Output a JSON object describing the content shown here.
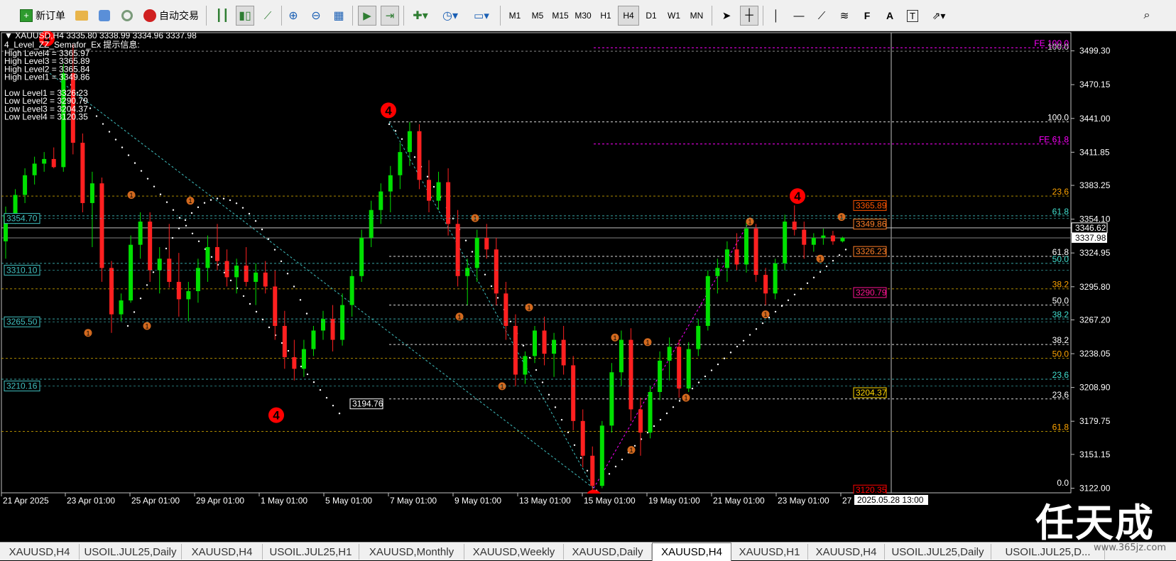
{
  "toolbar": {
    "new_order": "新订单",
    "auto_trading": "自动交易",
    "timeframes": [
      "M1",
      "M5",
      "M15",
      "M30",
      "H1",
      "H4",
      "D1",
      "W1",
      "MN"
    ],
    "active_timeframe": "H4"
  },
  "info": {
    "header": "XAUUSD,H4  3335.80 3338.99 3334.96 3337.98",
    "indicator": "4_Level_ZZ_Semafor_Ex 提示信息:",
    "lines": [
      "High Level4 = 3365.97",
      "High Level3 = 3365.89",
      "High Level2 = 3365.84",
      "High Level1 = 3349.86",
      "",
      "Low Level1 = 3326.23",
      "Low Level2 = 3290.79",
      "Low Level3 = 3204.37",
      "Low Level4 = 3120.35"
    ]
  },
  "chart_data": {
    "type": "candlestick",
    "symbol": "XAUUSD",
    "timeframe": "H4",
    "ylim": [
      3118,
      3515
    ],
    "y_ticks": [
      "3499.30",
      "3470.15",
      "3441.00",
      "3411.85",
      "3383.25",
      "3354.10",
      "3324.95",
      "3295.80",
      "3267.20",
      "3238.05",
      "3208.90",
      "3179.75",
      "3151.15",
      "3122.00"
    ],
    "x_labels": [
      "21 Apr 2025",
      "23 Apr 01:00",
      "25 Apr 01:00",
      "29 Apr 01:00",
      "1 May 01:00",
      "5 May 01:00",
      "7 May 01:00",
      "9 May 01:00",
      "13 May 01:00",
      "15 May 01:00",
      "19 May 01:00",
      "21 May 01:00",
      "23 May 01:00",
      "27"
    ],
    "crosshair_time": "2025.05.28 13:00",
    "price_labels": {
      "current": "3337.98",
      "crosshair": "3346.62"
    },
    "left_levels": [
      "3354.70",
      "3310.10",
      "3265.50",
      "3210.16"
    ],
    "swing_label": "3194.76",
    "right_level_boxes": [
      {
        "text": "3365.89",
        "price": 3365.9,
        "color": "#ff5500"
      },
      {
        "text": "3349.86",
        "price": 3349.86,
        "color": "#ff7f27"
      },
      {
        "text": "3326.23",
        "price": 3326.23,
        "color": "#ff7f27"
      },
      {
        "text": "3290.79",
        "price": 3290.79,
        "color": "#ff1493"
      },
      {
        "text": "3204.37",
        "price": 3204.37,
        "color": "#ffd700"
      },
      {
        "text": "3120.35",
        "price": 3120.35,
        "color": "#ff0000"
      }
    ],
    "fib_labels": [
      {
        "text": "FE 100.0",
        "price": 3502,
        "color": "#ff00ff"
      },
      {
        "text": "100.0",
        "price": 3499,
        "color": "#d0d0d0"
      },
      {
        "text": "100.0",
        "price": 3438,
        "color": "#ffffff"
      },
      {
        "text": "FE 61.8",
        "price": 3419,
        "color": "#ff00ff"
      },
      {
        "text": "23.6",
        "price": 3374,
        "color": "#ffa500"
      },
      {
        "text": "61.8",
        "price": 3357,
        "color": "#40e0d0"
      },
      {
        "text": "61.8",
        "price": 3322,
        "color": "#ffffff"
      },
      {
        "text": "50.0",
        "price": 3316,
        "color": "#40e0d0"
      },
      {
        "text": "38.2",
        "price": 3294,
        "color": "#ffa500"
      },
      {
        "text": "50.0",
        "price": 3280,
        "color": "#ffffff"
      },
      {
        "text": "38.2",
        "price": 3268,
        "color": "#40e0d0"
      },
      {
        "text": "38.2",
        "price": 3246,
        "color": "#ffffff"
      },
      {
        "text": "50.0",
        "price": 3234,
        "color": "#ffa500"
      },
      {
        "text": "23.6",
        "price": 3216,
        "color": "#40e0d0"
      },
      {
        "text": "23.6",
        "price": 3199,
        "color": "#ffffff"
      },
      {
        "text": "61.8",
        "price": 3171,
        "color": "#ffa500"
      },
      {
        "text": "0.0",
        "price": 3123,
        "color": "#ffffff"
      }
    ],
    "candles": [
      [
        3335,
        3365,
        3320,
        3358
      ],
      [
        3358,
        3380,
        3350,
        3375
      ],
      [
        3375,
        3398,
        3368,
        3392
      ],
      [
        3392,
        3408,
        3384,
        3402
      ],
      [
        3402,
        3412,
        3395,
        3406
      ],
      [
        3406,
        3416,
        3398,
        3399
      ],
      [
        3399,
        3488,
        3395,
        3480
      ],
      [
        3480,
        3505,
        3410,
        3420
      ],
      [
        3420,
        3428,
        3360,
        3368
      ],
      [
        3368,
        3395,
        3330,
        3385
      ],
      [
        3385,
        3390,
        3300,
        3312
      ],
      [
        3312,
        3318,
        3256,
        3272
      ],
      [
        3272,
        3290,
        3266,
        3284
      ],
      [
        3284,
        3340,
        3282,
        3332
      ],
      [
        3332,
        3360,
        3320,
        3352
      ],
      [
        3352,
        3360,
        3300,
        3310
      ],
      [
        3310,
        3330,
        3290,
        3320
      ],
      [
        3320,
        3350,
        3295,
        3300
      ],
      [
        3300,
        3325,
        3270,
        3285
      ],
      [
        3285,
        3300,
        3266,
        3292
      ],
      [
        3292,
        3320,
        3282,
        3312
      ],
      [
        3312,
        3340,
        3300,
        3330
      ],
      [
        3330,
        3350,
        3310,
        3318
      ],
      [
        3318,
        3328,
        3296,
        3304
      ],
      [
        3304,
        3320,
        3290,
        3314
      ],
      [
        3314,
        3330,
        3296,
        3300
      ],
      [
        3300,
        3316,
        3280,
        3308
      ],
      [
        3308,
        3318,
        3290,
        3296
      ],
      [
        3296,
        3310,
        3250,
        3262
      ],
      [
        3262,
        3275,
        3225,
        3235
      ],
      [
        3235,
        3250,
        3215,
        3225
      ],
      [
        3225,
        3250,
        3218,
        3242
      ],
      [
        3242,
        3262,
        3236,
        3258
      ],
      [
        3258,
        3275,
        3250,
        3268
      ],
      [
        3268,
        3280,
        3240,
        3250
      ],
      [
        3250,
        3290,
        3245,
        3280
      ],
      [
        3280,
        3310,
        3270,
        3305
      ],
      [
        3305,
        3345,
        3300,
        3338
      ],
      [
        3338,
        3370,
        3330,
        3362
      ],
      [
        3362,
        3385,
        3350,
        3378
      ],
      [
        3378,
        3400,
        3360,
        3392
      ],
      [
        3392,
        3420,
        3380,
        3412
      ],
      [
        3412,
        3438,
        3400,
        3430
      ],
      [
        3430,
        3436,
        3380,
        3388
      ],
      [
        3388,
        3405,
        3360,
        3370
      ],
      [
        3370,
        3395,
        3362,
        3386
      ],
      [
        3386,
        3398,
        3340,
        3350
      ],
      [
        3350,
        3362,
        3296,
        3305
      ],
      [
        3305,
        3320,
        3280,
        3312
      ],
      [
        3312,
        3345,
        3300,
        3338
      ],
      [
        3338,
        3350,
        3320,
        3328
      ],
      [
        3328,
        3338,
        3280,
        3290
      ],
      [
        3290,
        3300,
        3250,
        3262
      ],
      [
        3262,
        3272,
        3210,
        3220
      ],
      [
        3220,
        3240,
        3212,
        3236
      ],
      [
        3236,
        3262,
        3230,
        3258
      ],
      [
        3258,
        3270,
        3228,
        3238
      ],
      [
        3238,
        3256,
        3218,
        3250
      ],
      [
        3250,
        3262,
        3220,
        3228
      ],
      [
        3228,
        3236,
        3172,
        3180
      ],
      [
        3180,
        3190,
        3140,
        3150
      ],
      [
        3150,
        3158,
        3120,
        3124
      ],
      [
        3124,
        3180,
        3122,
        3176
      ],
      [
        3176,
        3230,
        3170,
        3222
      ],
      [
        3222,
        3258,
        3210,
        3250
      ],
      [
        3250,
        3260,
        3180,
        3190
      ],
      [
        3190,
        3200,
        3150,
        3170
      ],
      [
        3170,
        3210,
        3165,
        3205
      ],
      [
        3205,
        3240,
        3198,
        3232
      ],
      [
        3232,
        3252,
        3215,
        3244
      ],
      [
        3244,
        3250,
        3200,
        3208
      ],
      [
        3208,
        3248,
        3205,
        3242
      ],
      [
        3242,
        3268,
        3236,
        3262
      ],
      [
        3262,
        3310,
        3258,
        3305
      ],
      [
        3305,
        3320,
        3290,
        3312
      ],
      [
        3312,
        3335,
        3300,
        3328
      ],
      [
        3328,
        3342,
        3310,
        3315
      ],
      [
        3315,
        3352,
        3308,
        3346
      ],
      [
        3346,
        3350,
        3300,
        3306
      ],
      [
        3306,
        3312,
        3280,
        3290
      ],
      [
        3290,
        3320,
        3285,
        3316
      ],
      [
        3316,
        3358,
        3310,
        3352
      ],
      [
        3352,
        3366,
        3340,
        3345
      ],
      [
        3345,
        3352,
        3320,
        3332
      ],
      [
        3332,
        3342,
        3326,
        3338
      ],
      [
        3338,
        3346,
        3332,
        3340
      ],
      [
        3340,
        3344,
        3332,
        3335
      ],
      [
        3335,
        3339,
        3334,
        3338
      ]
    ]
  },
  "tabs": [
    "XAUUSD,H4",
    "USOIL.JUL25,Daily",
    "XAUUSD,H4",
    "USOIL.JUL25,H1",
    "XAUUSD,Monthly",
    "XAUUSD,Weekly",
    "XAUUSD,Daily",
    "XAUUSD,H4",
    "XAUUSD,H1",
    "XAUUSD,H4",
    "USOIL.JUL25,Daily",
    "USOIL.JUL25,D..."
  ],
  "active_tab": 7,
  "watermark": {
    "logo": "任天成",
    "url": "www.365jz.com"
  }
}
